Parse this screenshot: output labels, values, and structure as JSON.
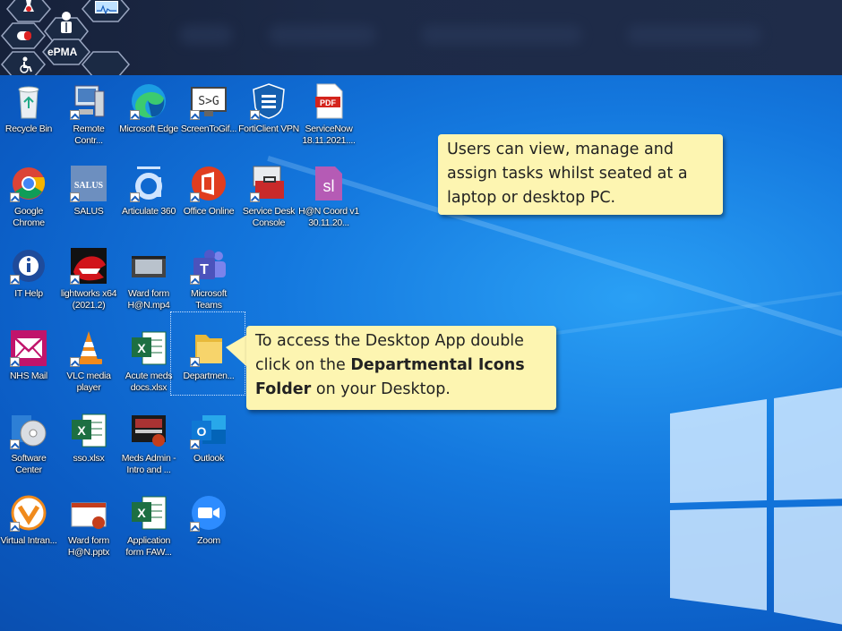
{
  "topbar": {
    "epma_label": "ePMA",
    "hex_icons": [
      "flask-icon",
      "monitor-waveform-icon",
      "doctor-icon",
      "pill-icon",
      "wheelchair-icon"
    ]
  },
  "desktop": {
    "icons": [
      {
        "label": "Recycle Bin"
      },
      {
        "label": "Remote Contr..."
      },
      {
        "label": "Microsoft Edge"
      },
      {
        "label": "ScreenToGif..."
      },
      {
        "label": "FortiClient VPN"
      },
      {
        "label": "ServiceNow 18.11.2021...."
      },
      {
        "label": "Google Chrome"
      },
      {
        "label": "SALUS"
      },
      {
        "label": "Articulate 360"
      },
      {
        "label": "Office Online"
      },
      {
        "label": "Service Desk Console"
      },
      {
        "label": "H@N Coord v1 30.11.20..."
      },
      {
        "label": "IT Help"
      },
      {
        "label": "lightworks x64 (2021.2)"
      },
      {
        "label": "Ward form H@N.mp4"
      },
      {
        "label": "Microsoft Teams"
      },
      {
        "label": "NHS Mail"
      },
      {
        "label": "VLC media player"
      },
      {
        "label": "Acute meds docs.xlsx"
      },
      {
        "label": "Departmen..."
      },
      {
        "label": "Software Center"
      },
      {
        "label": "sso.xlsx"
      },
      {
        "label": "Meds Admin - Intro and ..."
      },
      {
        "label": "Outlook"
      },
      {
        "label": "Virtual Intran..."
      },
      {
        "label": "Ward form H@N.pptx"
      },
      {
        "label": "Application form FAW..."
      },
      {
        "label": "Zoom"
      }
    ],
    "icon_texts": {
      "screentogif": "S>G",
      "pdf": "PDF",
      "salus": "SALUS",
      "hon_coord": "sl",
      "excel": "X",
      "outlook": "O",
      "office": "O"
    }
  },
  "callouts": {
    "tasks": "Users can view, manage and assign tasks whilst seated at a laptop or desktop PC.",
    "access_prefix": "To access the Desktop App double click on the ",
    "access_bold": "Departmental Icons Folder",
    "access_suffix": " on your Desktop."
  },
  "colors": {
    "callout_bg": "#fdf5b1",
    "desktop_blue": "#1478de",
    "topbar": "#1d2a47"
  }
}
